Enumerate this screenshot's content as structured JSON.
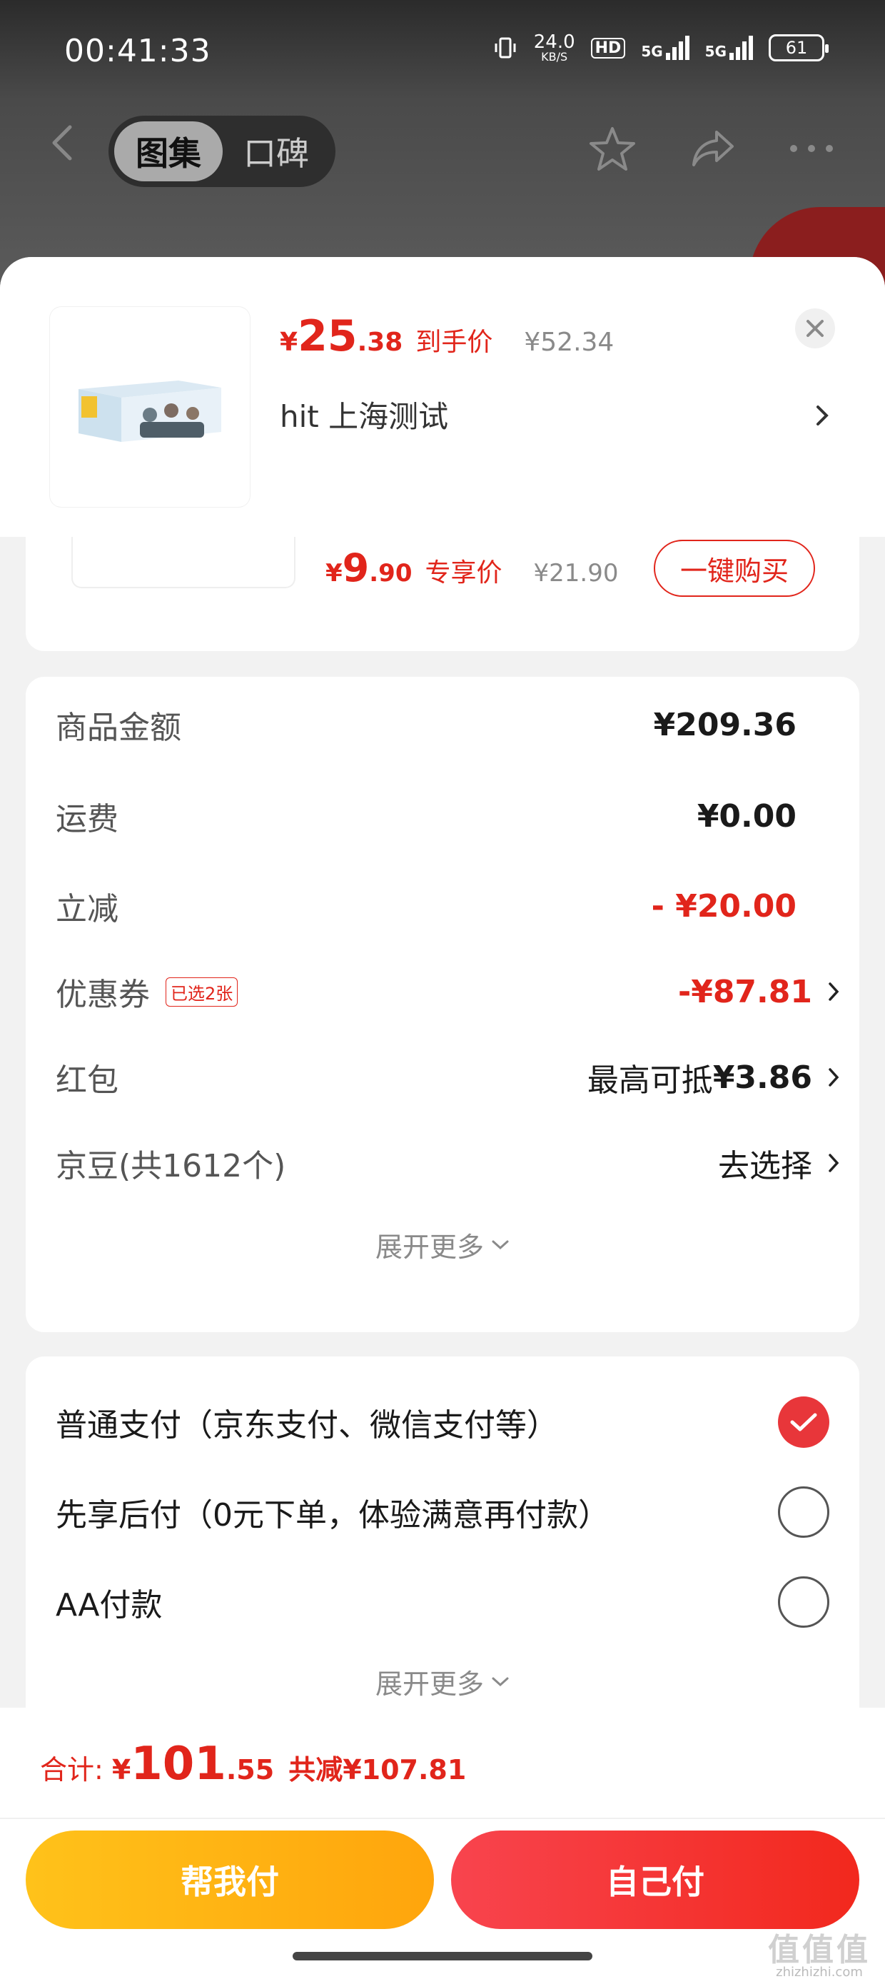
{
  "status_bar": {
    "time": "00:41:33",
    "net_speed": "24.0",
    "net_unit": "KB/S",
    "hd": "HD",
    "signal1": "5G",
    "signal2": "5G",
    "battery": "61"
  },
  "nav": {
    "tabs": [
      {
        "label": "图集",
        "active": true
      },
      {
        "label": "口碑",
        "active": false
      }
    ],
    "icons": [
      "back-icon",
      "star-icon",
      "share-icon",
      "more-icon"
    ]
  },
  "product": {
    "currency": "¥",
    "price_int": "25",
    "price_dec": ".38",
    "price_tag": "到手价",
    "original_price": "¥52.34",
    "title": "hit  上海测试"
  },
  "recommend": {
    "currency": "¥",
    "price_int": "9",
    "price_dec": ".90",
    "price_tag": "专享价",
    "original_price": "¥21.90",
    "buy_label": "一键购买"
  },
  "cost": {
    "rows": [
      {
        "label": "商品金额",
        "value": "¥209.36"
      },
      {
        "label": "运费",
        "value": "¥0.00"
      },
      {
        "label": "立减",
        "value": "- ¥20.00"
      },
      {
        "label": "优惠券",
        "badge": "已选2张",
        "value": "-¥87.81"
      },
      {
        "label": "红包",
        "value_prefix": "最高可抵",
        "value": "¥3.86"
      },
      {
        "label": "京豆(共1612个)",
        "value": "去选择"
      }
    ],
    "expand_label": "展开更多"
  },
  "payment": {
    "options": [
      {
        "label": "普通支付（京东支付、微信支付等）",
        "selected": true
      },
      {
        "label": "先享后付（0元下单，体验满意再付款）",
        "selected": false
      },
      {
        "label": "AA付款",
        "selected": false
      }
    ],
    "expand_label": "展开更多"
  },
  "footer": {
    "total_label": "合计:",
    "currency": "¥",
    "total_int": "101",
    "total_dec": ".55",
    "total_saved": "共减¥107.81",
    "help_pay_label": "帮我付",
    "self_pay_label": "自己付",
    "watermark_big": "值值值",
    "watermark_small": "zhizhizhi.com"
  },
  "colors": {
    "accent_red": "#e1251b",
    "checked_red": "#e8363a",
    "help_gradient": [
      "#ffc21a",
      "#ffa50c"
    ],
    "self_gradient": [
      "#f8444e",
      "#f2281d"
    ]
  }
}
